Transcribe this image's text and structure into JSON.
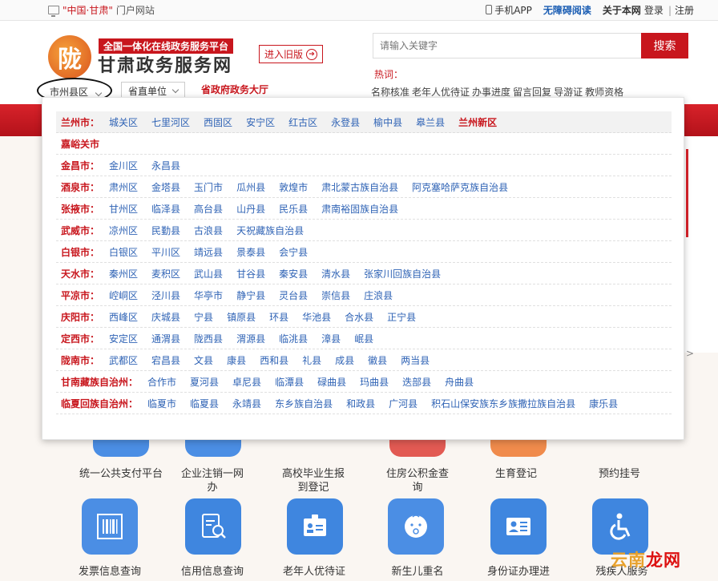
{
  "topbar": {
    "portal_prefix": "\"中国·甘肃\"",
    "portal_suffix": "门户网站",
    "mobile_app": "手机APP",
    "accessible": "无障碍阅读",
    "about": "关于本网",
    "login": "登录",
    "logout": "注册",
    "separator": "|"
  },
  "header": {
    "logo_glyph": "陇",
    "platform_tag": "全国一体化在线政务服务平台",
    "site_name": "甘肃政务服务网",
    "old_version": "进入旧版",
    "search_placeholder": "请输入关键字",
    "search_button": "搜索",
    "hot_label": "热词：",
    "hot_words": [
      "名称核准",
      "老年人优待证",
      "办事进度",
      "留言回复",
      "导游证",
      "教师资格"
    ]
  },
  "selectors": {
    "region": "市州县区",
    "dept": "省直单位",
    "hall": "省政府政务大厅"
  },
  "dropdown": {
    "cities": [
      {
        "name": "兰州市：",
        "counties": [
          "城关区",
          "七里河区",
          "西固区",
          "安宁区",
          "红古区",
          "永登县",
          "榆中县",
          "皋兰县"
        ],
        "special": "兰州新区"
      },
      {
        "name": "嘉峪关市",
        "counties": []
      },
      {
        "name": "金昌市：",
        "counties": [
          "金川区",
          "永昌县"
        ]
      },
      {
        "name": "酒泉市：",
        "counties": [
          "肃州区",
          "金塔县",
          "玉门市",
          "瓜州县",
          "敦煌市",
          "肃北蒙古族自治县",
          "阿克塞哈萨克族自治县"
        ]
      },
      {
        "name": "张掖市：",
        "counties": [
          "甘州区",
          "临泽县",
          "高台县",
          "山丹县",
          "民乐县",
          "肃南裕固族自治县"
        ]
      },
      {
        "name": "武威市：",
        "counties": [
          "凉州区",
          "民勤县",
          "古浪县",
          "天祝藏族自治县"
        ]
      },
      {
        "name": "白银市：",
        "counties": [
          "白银区",
          "平川区",
          "靖远县",
          "景泰县",
          "会宁县"
        ]
      },
      {
        "name": "天水市：",
        "counties": [
          "秦州区",
          "麦积区",
          "武山县",
          "甘谷县",
          "秦安县",
          "清水县",
          "张家川回族自治县"
        ]
      },
      {
        "name": "平凉市：",
        "counties": [
          "崆峒区",
          "泾川县",
          "华亭市",
          "静宁县",
          "灵台县",
          "崇信县",
          "庄浪县"
        ]
      },
      {
        "name": "庆阳市：",
        "counties": [
          "西峰区",
          "庆城县",
          "宁县",
          "镇原县",
          "环县",
          "华池县",
          "合水县",
          "正宁县"
        ]
      },
      {
        "name": "定西市：",
        "counties": [
          "安定区",
          "通渭县",
          "陇西县",
          "渭源县",
          "临洮县",
          "漳县",
          "岷县"
        ]
      },
      {
        "name": "陇南市：",
        "counties": [
          "武都区",
          "宕昌县",
          "文县",
          "康县",
          "西和县",
          "礼县",
          "成县",
          "徽县",
          "两当县"
        ]
      },
      {
        "name": "甘南藏族自治州：",
        "counties": [
          "合作市",
          "夏河县",
          "卓尼县",
          "临潭县",
          "碌曲县",
          "玛曲县",
          "迭部县",
          "舟曲县"
        ]
      },
      {
        "name": "临夏回族自治州：",
        "counties": [
          "临夏市",
          "临夏县",
          "永靖县",
          "东乡族自治县",
          "和政县",
          "广河县",
          "积石山保安族东乡族撒拉族自治县",
          "康乐县"
        ]
      }
    ]
  },
  "services_row1": [
    "统一公共支付平台",
    "企业注销一网办",
    "高校毕业生报到登记",
    "住房公积金查询",
    "生育登记",
    "预约挂号"
  ],
  "services_row2": [
    "发票信息查询",
    "信用信息查询",
    "老年人优待证",
    "新生儿重名",
    "身份证办理进",
    "残疾人服务"
  ],
  "side": {
    "gt": ">"
  },
  "watermark": {
    "a": "云南",
    "b": "龙网"
  }
}
